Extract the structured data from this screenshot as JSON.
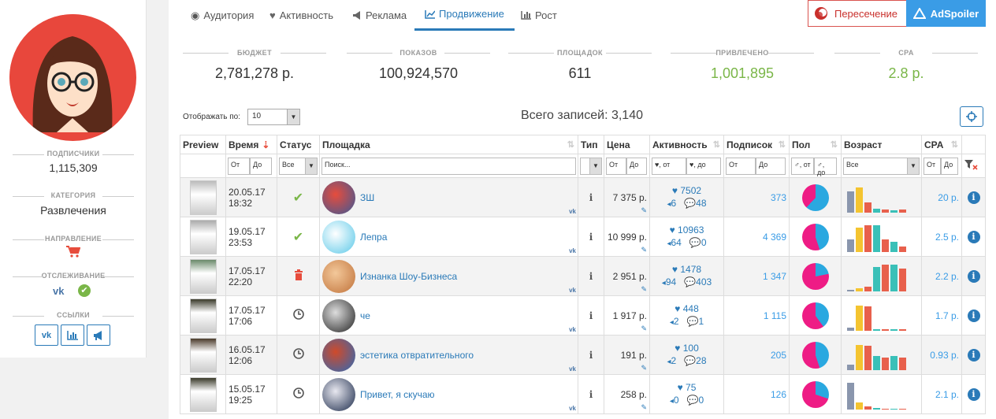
{
  "sidebar": {
    "subscribers_label": "ПОДПИСЧИКИ",
    "subscribers_value": "1,115,309",
    "category_label": "КАТЕГОРИЯ",
    "category_value": "Развлечения",
    "direction_label": "НАПРАВЛЕНИЕ",
    "tracking_label": "ОТСЛЕЖИВАНИЕ",
    "links_label": "ССЫЛКИ"
  },
  "tabs": [
    {
      "label": "Аудитория",
      "icon": "globe-icon"
    },
    {
      "label": "Активность",
      "icon": "heart-icon"
    },
    {
      "label": "Реклама",
      "icon": "bullhorn-icon"
    },
    {
      "label": "Продвижение",
      "icon": "line-chart-icon",
      "active": true
    },
    {
      "label": "Рост",
      "icon": "bar-chart-icon"
    }
  ],
  "buttons": {
    "cross": "Пересечение",
    "adspoiler": "AdSpoiler"
  },
  "stats": [
    {
      "label": "БЮДЖЕТ",
      "value": "2,781,278 р."
    },
    {
      "label": "ПОКАЗОВ",
      "value": "100,924,570"
    },
    {
      "label": "ПЛОЩАДОК",
      "value": "611"
    },
    {
      "label": "ПРИВЛЕЧЕНО",
      "value": "1,001,895"
    },
    {
      "label": "CPA",
      "value": "2.8 р."
    }
  ],
  "controls": {
    "show_label": "Отображать по:",
    "show_value": "10",
    "total": "Всего записей: 3,140"
  },
  "colors": {
    "accent": "#2a7ab8",
    "green": "#7ab648",
    "red": "#e74c3c",
    "pink": "#ee1c85",
    "cyan": "#2aa8e0"
  },
  "table": {
    "headers": [
      "Preview",
      "Время",
      "Статус",
      "Площадка",
      "Тип",
      "Цена",
      "Активность",
      "Подписок",
      "Пол",
      "Возраст",
      "CPA"
    ],
    "filters": {
      "from": "От",
      "to": "До",
      "all": "Все",
      "search": "Поиск...",
      "act_from": "♥, от",
      "act_to": "♥, до"
    },
    "rows": [
      {
        "date": "20.05.17",
        "time": "18:32",
        "status": "ok",
        "name": "ЗШ",
        "price": "7 375 р.",
        "likes": "7502",
        "reposts": "6",
        "comments": "48",
        "subs": "373",
        "cpa": "20 р.",
        "male": 0.62,
        "ages": [
          0.75,
          0.9,
          0.35,
          0.15,
          0.12,
          0.08,
          0.1
        ]
      },
      {
        "date": "19.05.17",
        "time": "23:53",
        "status": "ok",
        "name": "Лепра",
        "price": "10 999 р.",
        "likes": "10963",
        "reposts": "64",
        "comments": "0",
        "subs": "4 369",
        "cpa": "2.5 р.",
        "male": 0.45,
        "ages": [
          0.45,
          0.85,
          0.95,
          0.95,
          0.45,
          0.35,
          0.2
        ]
      },
      {
        "date": "17.05.17",
        "time": "22:20",
        "status": "deleted",
        "name": "Изнанка Шоу-Бизнеса",
        "price": "2 951 р.",
        "likes": "1478",
        "reposts": "94",
        "comments": "403",
        "subs": "1 347",
        "cpa": "2.2 р.",
        "male": 0.22,
        "ages": [
          0.05,
          0.1,
          0.18,
          0.85,
          0.95,
          0.95,
          0.8
        ]
      },
      {
        "date": "17.05.17",
        "time": "17:06",
        "status": "pending",
        "name": "че",
        "price": "1 917 р.",
        "likes": "448",
        "reposts": "2",
        "comments": "1",
        "subs": "1 115",
        "cpa": "1.7 р.",
        "male": 0.4,
        "ages": [
          0.1,
          0.9,
          0.85,
          0.06,
          0.06,
          0.05,
          0.05
        ]
      },
      {
        "date": "16.05.17",
        "time": "12:06",
        "status": "pending",
        "name": "эстетика отвратительного",
        "price": "191 р.",
        "likes": "100",
        "reposts": "2",
        "comments": "28",
        "subs": "205",
        "cpa": "0.93 р.",
        "male": 0.45,
        "ages": [
          0.2,
          0.9,
          0.85,
          0.5,
          0.45,
          0.5,
          0.45
        ]
      },
      {
        "date": "15.05.17",
        "time": "19:25",
        "status": "pending",
        "name": "Привет, я скучаю",
        "price": "258 р.",
        "likes": "75",
        "reposts": "0",
        "comments": "0",
        "subs": "126",
        "cpa": "2.1 р.",
        "male": 0.3,
        "ages": [
          0.95,
          0.25,
          0.1,
          0.05,
          0.04,
          0.04,
          0.04
        ]
      }
    ]
  }
}
